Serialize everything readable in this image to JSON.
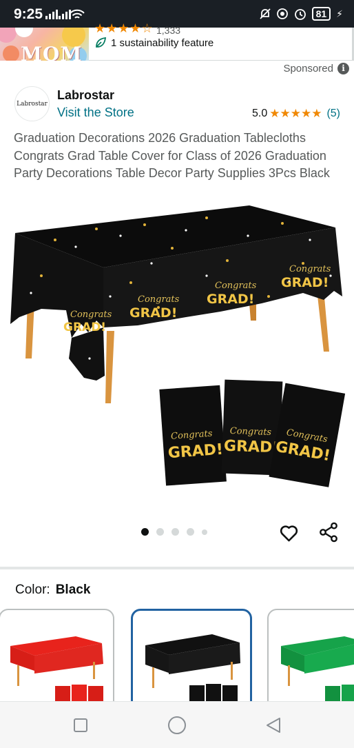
{
  "status_bar": {
    "time": "9:25",
    "battery": "81",
    "icons": [
      "signal-icon",
      "signal-icon",
      "wifi-icon",
      "mute-icon",
      "alarm-icon",
      "clock-icon",
      "battery-icon",
      "charging-icon"
    ]
  },
  "top_strip": {
    "thumbnail_text": "MOM",
    "rating_count": "1,333",
    "sustainability": "1 sustainability feature"
  },
  "sponsored": "Sponsored",
  "brand": {
    "logo_text": "Labrostar",
    "name": "Labrostar",
    "visit_store": "Visit the Store",
    "rating": "5.0",
    "stars": "★★★★★",
    "review_count": "(5)"
  },
  "product": {
    "title": "Graduation Decorations 2026 Graduation Tablecloths Congrats Grad Table Cover for Class of 2026 Graduation Party Decorations Table Decor Party Supplies 3Pcs Black",
    "image_text": {
      "script": "Congrats",
      "grad": "GRAD!"
    },
    "carousel": {
      "count": 5,
      "active_index": 0
    }
  },
  "color": {
    "label": "Color:",
    "value": "Black",
    "swatches": [
      {
        "name": "Red",
        "hex": "#e8231c"
      },
      {
        "name": "Black",
        "hex": "#111111",
        "selected": true
      },
      {
        "name": "Green",
        "hex": "#16a34a"
      }
    ]
  },
  "colors": {
    "link": "#007185",
    "star": "#f08804",
    "selected_border": "#2162a1"
  }
}
